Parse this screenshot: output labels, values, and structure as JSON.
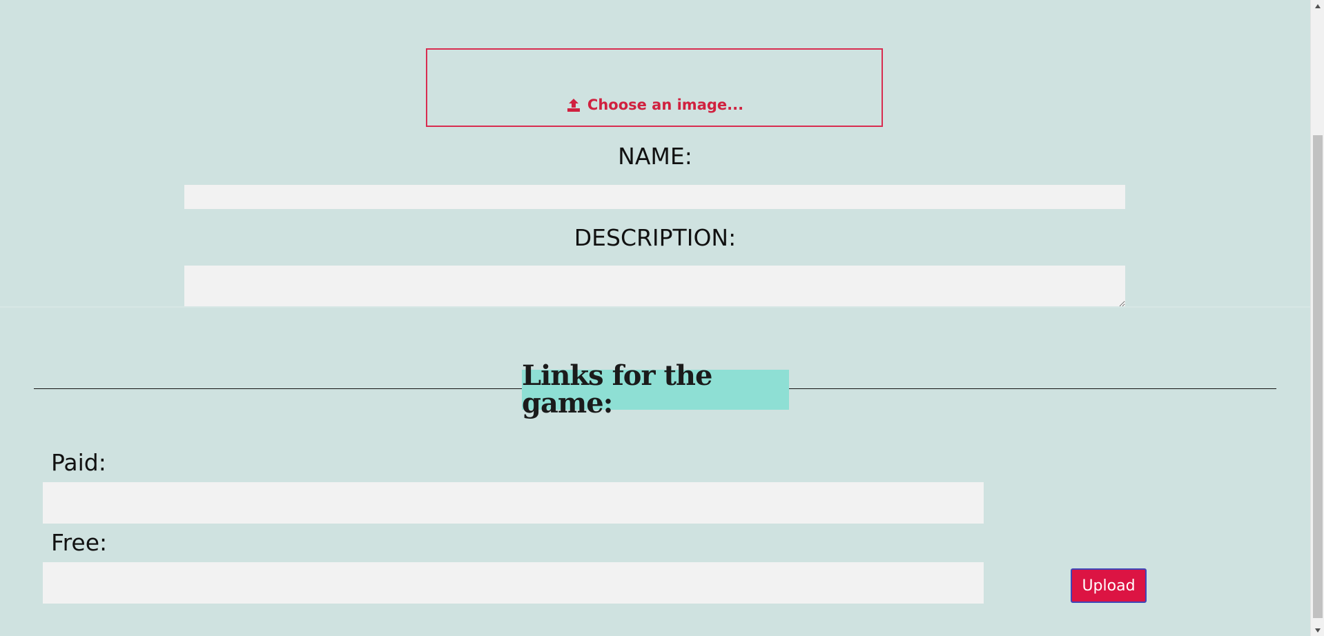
{
  "form": {
    "image_upload_label": "Choose an image...",
    "image_upload_icon": "upload-icon",
    "name_label": "NAME:",
    "name_value": "",
    "description_label": "DESCRIPTION:",
    "description_value": ""
  },
  "links": {
    "heading": "Links for the game:",
    "paid_label": "Paid:",
    "paid_value": "",
    "free_label": "Free:",
    "free_value": "",
    "upload_button_label": "Upload"
  },
  "colors": {
    "page_background": "#cfe2e0",
    "accent_red": "#d82b4f",
    "heading_highlight": "#8edfd4",
    "input_background": "#f2f2f2",
    "button_background": "#dc1443"
  },
  "scrollbar": {
    "up_icon": "chevron-up-icon",
    "down_icon": "chevron-down-icon"
  }
}
